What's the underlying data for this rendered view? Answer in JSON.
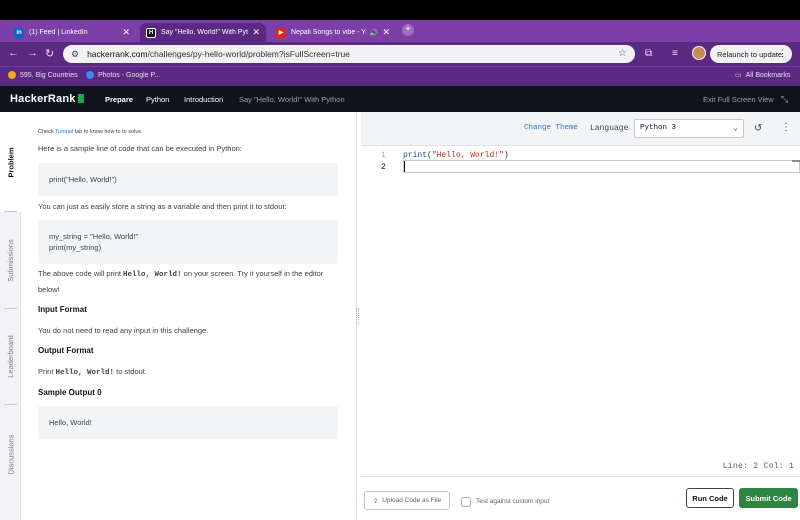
{
  "browser": {
    "tabs": [
      {
        "icon": "linkedin-icon",
        "icon_text": "in",
        "color": "#0a66c2",
        "label": "(1) Feed | LinkedIn"
      },
      {
        "icon": "hackerrank-icon",
        "icon_text": "H",
        "color": "#0e141e",
        "label": "Say \"Hello, World!\" With Pyth"
      },
      {
        "icon": "youtube-icon",
        "icon_text": "▶",
        "color": "#e62117",
        "label": "Nepali Songs to vibe - Yo"
      }
    ],
    "url_host": "hackerrank.com",
    "url_path": "/challenges/py-hello-world/problem?isFullScreen=true",
    "relaunch_label": "Relaunch to update",
    "bookmarks": [
      {
        "label": "595. Big Countries",
        "color": "#f5a623"
      },
      {
        "label": "Photos - Google P...",
        "color": "#4285f4"
      }
    ],
    "all_bookmarks_label": "All Bookmarks"
  },
  "header": {
    "logo": "HackerRank",
    "breadcrumbs": [
      "Prepare",
      "Python",
      "Introduction",
      "Say \"Hello, World!\" With Python"
    ],
    "exit_fullscreen": "Exit Full Screen View"
  },
  "side_tabs": [
    "Problem",
    "Submissions",
    "Leaderboard",
    "Discussions"
  ],
  "problem": {
    "hint_prefix": "Check ",
    "hint_link": "Tutorial",
    "hint_suffix": " tab to know how to to solve.",
    "intro": "Here is a sample line of code that can be executed in Python:",
    "code1": "print(\"Hello, World!\")",
    "store_text": "You can just as easily store a string as a variable and then print it to stdout:",
    "code2_line1": "my_string  =  \"Hello, World!\"",
    "code2_line2": "print(my_string)",
    "above_prefix": "The above code will print ",
    "above_code": "Hello, World!",
    "above_suffix": " on your screen. Try it yourself in the editor",
    "above_line2": "below!",
    "input_heading": "Input Format",
    "input_text": "You do not need to read any input in this challenge.",
    "output_heading": "Output Format",
    "output_prefix": "Print ",
    "output_code": "Hello, World!",
    "output_suffix": " to stdout.",
    "sample_heading": "Sample Output 0",
    "sample_output": "Hello, World!"
  },
  "editor": {
    "change_theme": "Change Theme",
    "language_label": "Language",
    "language_value": "Python 3",
    "line_numbers": [
      "1",
      "2"
    ],
    "code_keyword": "print",
    "code_open": "(",
    "code_string": "\"Hello, World!\"",
    "code_close": ")",
    "status": "Line: 2 Col: 1"
  },
  "footer": {
    "upload_label": "Upload Code as File",
    "test_label": "Test against custom input",
    "run_label": "Run Code",
    "submit_label": "Submit Code"
  }
}
